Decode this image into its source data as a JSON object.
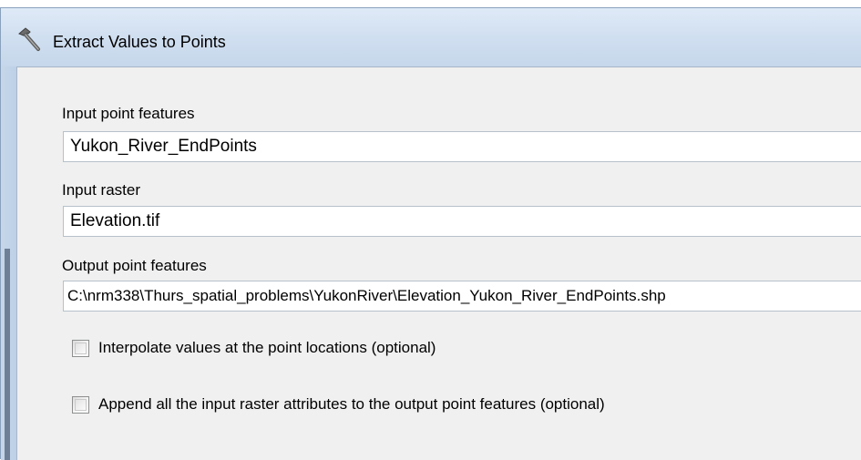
{
  "window": {
    "title": "Extract Values to Points"
  },
  "form": {
    "input_point_features": {
      "label": "Input point features",
      "value": "Yukon_River_EndPoints"
    },
    "input_raster": {
      "label": "Input raster",
      "value": "Elevation.tif"
    },
    "output_point_features": {
      "label": "Output point features",
      "value": "C:\\nrm338\\Thurs_spatial_problems\\YukonRiver\\Elevation_Yukon_River_EndPoints.shp"
    },
    "options": [
      {
        "label": "Interpolate values at the point locations (optional)",
        "checked": false
      },
      {
        "label": "Append all the input raster attributes to the output point features (optional)",
        "checked": false
      }
    ]
  },
  "icons": {
    "title": "hammer-icon"
  }
}
